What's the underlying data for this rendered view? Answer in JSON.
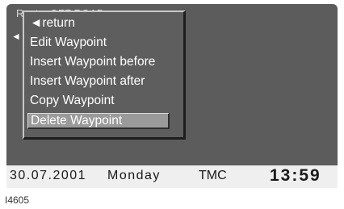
{
  "screen": {
    "route_title": "Route: OFF ROAD",
    "left_arrow": "◄"
  },
  "menu": {
    "items": [
      {
        "label": "◄return"
      },
      {
        "label": "Edit Waypoint"
      },
      {
        "label": "Insert Waypoint before"
      },
      {
        "label": "Insert Waypoint after"
      },
      {
        "label": "Copy Waypoint"
      },
      {
        "label": "Delete Waypoint",
        "selected": true
      }
    ]
  },
  "status_bar": {
    "date": "30.07.2001",
    "day": "Monday",
    "tmc": "TMC",
    "time": "13:59"
  },
  "figure_id": "I4605",
  "colors": {
    "screen_bg": "#5c5c5c",
    "highlight": "#9a9a9a",
    "status_bg": "#efefef"
  }
}
